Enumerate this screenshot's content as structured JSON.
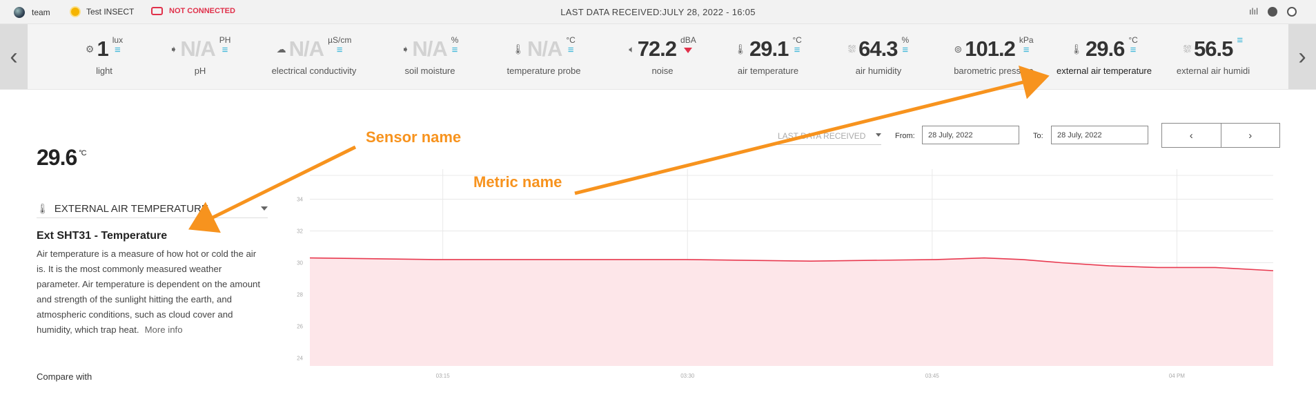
{
  "topbar": {
    "team_label": "team",
    "device_label": "Test INSECT",
    "status_label": "NOT CONNECTED",
    "last_data": "LAST DATA RECEIVED:JULY 28, 2022 - 16:05",
    "status_color": "#e0304a"
  },
  "metrics": [
    {
      "icon": "gear-icon",
      "value": "1",
      "unit": "lux",
      "label": "light"
    },
    {
      "icon": "probe-icon",
      "value": "N/A",
      "unit": "PH",
      "label": "pH"
    },
    {
      "icon": "cloud-icon",
      "value": "N/A",
      "unit": "µS/cm",
      "label": "electrical conductivity"
    },
    {
      "icon": "probe-icon",
      "value": "N/A",
      "unit": "%",
      "label": "soil moisture"
    },
    {
      "icon": "thermometer-icon",
      "value": "N/A",
      "unit": "°C",
      "label": "temperature probe"
    },
    {
      "icon": "speaker-icon",
      "value": "72.2",
      "unit": "dBA",
      "label": "noise"
    },
    {
      "icon": "thermometer-icon",
      "value": "29.1",
      "unit": "°C",
      "label": "air temperature"
    },
    {
      "icon": "rain-cloud-icon",
      "value": "64.3",
      "unit": "%",
      "label": "air humidity"
    },
    {
      "icon": "pressure-icon",
      "value": "101.2",
      "unit": "kPa",
      "label": "barometric pressure"
    },
    {
      "icon": "thermometer-icon",
      "value": "29.6",
      "unit": "°C",
      "label": "external air temperature"
    },
    {
      "icon": "rain-cloud-icon",
      "value": "56.5",
      "unit": "",
      "label": "external air humidi"
    }
  ],
  "detail": {
    "value": "29.6",
    "unit": "°C",
    "metric_select": "EXTERNAL AIR TEMPERATURE",
    "sensor_title": "Ext SHT31 - Temperature",
    "description": "Air temperature is a measure of how hot or cold the air is. It is the most commonly measured weather parameter. Air temperature is dependent on the amount and strength of the sunlight hitting the earth, and atmospheric conditions, such as cloud cover and humidity, which trap heat.",
    "more_info": "More info",
    "compare_label": "Compare with"
  },
  "controls": {
    "range_select": "LAST DATA RECEIVED",
    "from_label": "From:",
    "from_value": "28 July, 2022",
    "to_label": "To:",
    "to_value": "28 July, 2022",
    "prev_glyph": "‹",
    "next_glyph": "›"
  },
  "annotations": {
    "sensor_name": "Sensor name",
    "metric_name": "Metric name",
    "color": "#f7931e"
  },
  "chart_data": {
    "type": "area",
    "x_ticks": [
      "03:15",
      "03:30",
      "03:45",
      "04 PM"
    ],
    "y_ticks": [
      "24",
      "26",
      "28",
      "30",
      "32",
      "34"
    ],
    "ylim": [
      23.5,
      35.5
    ],
    "x_positions": [
      0,
      0.13,
      0.26,
      0.39,
      0.52,
      0.65,
      0.7,
      0.74,
      0.78,
      0.83,
      0.88,
      0.94,
      1.0
    ],
    "values": [
      30.3,
      30.2,
      30.2,
      30.2,
      30.1,
      30.2,
      30.3,
      30.2,
      30.0,
      29.8,
      29.7,
      29.7,
      29.5
    ],
    "x_tick_positions": [
      0.138,
      0.392,
      0.646,
      0.9
    ],
    "line_color": "#e8394f",
    "fill_color": "#fde6e9",
    "grid": true
  }
}
